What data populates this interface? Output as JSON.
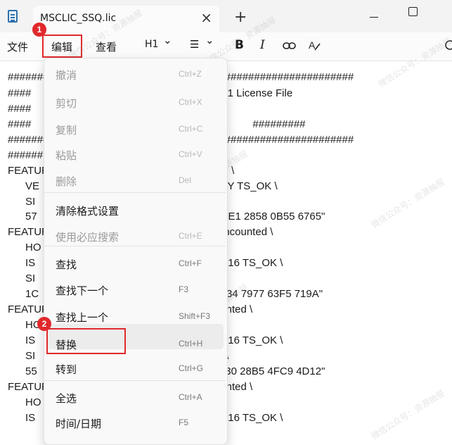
{
  "tab": {
    "title": "MSCLIC_SSQ.lic",
    "close": "×",
    "new": "+"
  },
  "window": {
    "close": "×"
  },
  "menubar": {
    "file": "文件",
    "edit": "编辑",
    "view": "查看"
  },
  "toolbar": {
    "heading": "H1",
    "heading_arrow": "⌄",
    "list": "☰",
    "list_arrow": "⌄",
    "bold": "B",
    "italic": "I"
  },
  "badges": {
    "one": "1",
    "two": "2"
  },
  "editor_lines": [
    "###########################################################",
    "####                                       (MSCLIC) 22024.1 License File",
    "####",
    "####                                       ISQUAD-SSQ              #########",
    "###########################################################",
    "######",
    "FEATURE                                  nent uncounted \\",
    "      VE                                    CN\" HOSTID=ANY TS_OK \\",
    "      SI                                    51B6 566F 5E8A \\",
    "      57                                    F5 4CF5 53DC 40E1 2858 0B55 6765\"",
    "FEATURE                                  1 permanent uncounted \\",
    "      HO                                   SN=K000001 \\",
    "      IS                                     START=01-jan-2016 TS_OK \\",
    "      SI                                    D4E 6DD7 7C10 \\",
    "      1C                                   64 6BAE 6BB1 5434 7977 63F5 719A\"",
    "FEATURE                                  rmanent uncounted \\",
    "      HO                                   SN=K000001 \\",
    "      IS                                     START=01-jan-2016 TS_OK \\",
    "      SI                                    71ED 57DB 6483 \\",
    "      55                                    D6 148C 1214 6130 28B5 4FC9 4D12\"",
    "FEATURE                                  rmanent uncounted \\",
    "      HO                                   SN=K000001 \\",
    "      IS                                     START=01-jan-2016 TS_OK \\"
  ],
  "edit_menu": [
    {
      "label": "撤消",
      "shortcut": "Ctrl+Z",
      "disabled": true
    },
    {
      "label": "剪切",
      "shortcut": "Ctrl+X",
      "disabled": true
    },
    {
      "label": "复制",
      "shortcut": "Ctrl+C",
      "disabled": true
    },
    {
      "label": "粘贴",
      "shortcut": "Ctrl+V",
      "disabled": true
    },
    {
      "label": "删除",
      "shortcut": "Del",
      "disabled": true
    },
    {
      "label": "清除格式设置",
      "shortcut": "",
      "disabled": false
    },
    {
      "label": "使用必应搜索",
      "shortcut": "Ctrl+E",
      "disabled": true
    },
    {
      "label": "查找",
      "shortcut": "Ctrl+F",
      "disabled": false
    },
    {
      "label": "查找下一个",
      "shortcut": "F3",
      "disabled": false
    },
    {
      "label": "查找上一个",
      "shortcut": "Shift+F3",
      "disabled": false
    },
    {
      "label": "替换",
      "shortcut": "Ctrl+H",
      "disabled": false
    },
    {
      "label": "转到",
      "shortcut": "Ctrl+G",
      "disabled": false
    },
    {
      "label": "全选",
      "shortcut": "Ctrl+A",
      "disabled": false
    },
    {
      "label": "时间/日期",
      "shortcut": "F5",
      "disabled": false
    }
  ],
  "watermark": "微信公众号：资源抽屉",
  "colors": {
    "annotation": "#e0292c",
    "tab_bar": "#f3f3f3",
    "menu_bg": "#f9f9f9"
  }
}
